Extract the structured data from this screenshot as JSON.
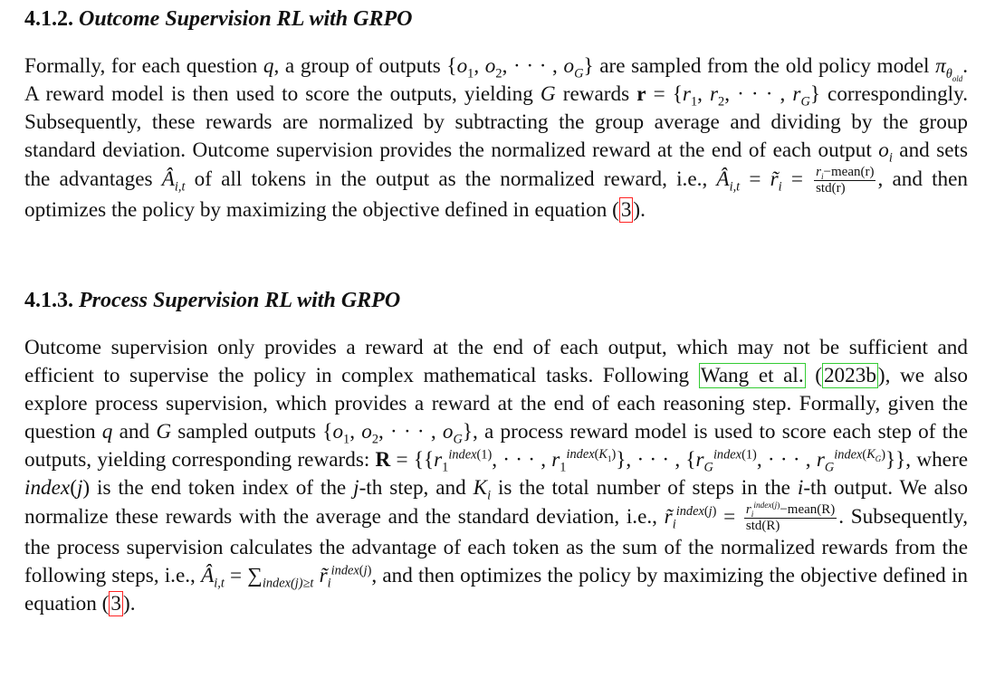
{
  "sections": [
    {
      "number": "4.1.2.",
      "title": "Outcome Supervision RL with GRPO"
    },
    {
      "number": "4.1.3.",
      "title": "Process Supervision RL with GRPO"
    }
  ],
  "outcome": {
    "t1": "Formally, for each question ",
    "q": "q",
    "t2": ", a group of outputs {",
    "o_set": "o",
    "t3": "} are sampled from the old policy model ",
    "pi": "π",
    "theta_old": "θ",
    "old": "old",
    "t4": ". A reward model is then used to score the outputs, yielding ",
    "G": "G",
    "t5": " rewards ",
    "r_bold": "r",
    "t6": " = {",
    "t7": "} correspondingly. Subsequently, these rewards are normalized by subtracting the group average and dividing by the group standard deviation. Outcome supervision provides the normalized reward at the end of each output ",
    "o_i": "o",
    "i": "i",
    "t8": " and sets the advantages ",
    "A_hat": "Â",
    "it": "i,t",
    "t9": " of all tokens in the output as the normalized reward, i.e., ",
    "eq_mid": " = ",
    "r_tilde": "r̃",
    "frac_num": "r",
    "frac_num_tail": "−mean(r)",
    "frac_den": "std(r)",
    "t10": ", and then optimizes the policy by maximizing the objective defined in equation (",
    "eq_ref": "3",
    "t11": ")."
  },
  "process": {
    "t1": "Outcome supervision only provides a reward at the end of each output, which may not be sufficient and efficient to supervise the policy in complex mathematical tasks. Following ",
    "cite_a": "Wang et al.",
    "t2": " (",
    "cite_b": "2023b",
    "t3": "), we also explore process supervision, which provides a reward at the end of each reasoning step. Formally, given the question ",
    "q": "q",
    "t4": " and ",
    "G": "G",
    "t5": " sampled outputs {",
    "t6": "}, a process reward model is used to score each step of the outputs, yielding corresponding rewards: ",
    "R_bold": "R",
    "t7": ", where ",
    "index_j": "index",
    "t8": " is the end token index of the ",
    "j": "j",
    "t9": "-th step, and ",
    "K_i": "K",
    "t10": " is the total number of steps in the ",
    "i": "i",
    "t11": "-th output. We also normalize these rewards with the average and the standard deviation, i.e., ",
    "frac_tail": "−mean(R)",
    "frac_den": "std(R)",
    "t12": ". Subsequently, the process supervision calculates the advantage of each token as the sum of the normalized rewards from the following steps, i.e., ",
    "sum": "∑",
    "sum_sub": "index(j)≥t",
    "t13": ", and then optimizes the policy by maximizing the objective defined in equation (",
    "eq_ref": "3",
    "t14": ")."
  }
}
